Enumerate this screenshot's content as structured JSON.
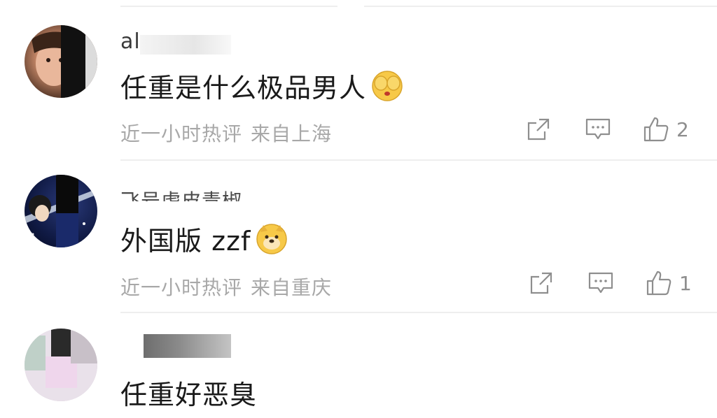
{
  "comments": [
    {
      "username": "al",
      "text": "任重是什么极品男人",
      "emoji": "covering-eyes-emoji",
      "time": "近一小时热评",
      "location": "来自上海",
      "likes": "2"
    },
    {
      "username": "飞号虎皮青椒",
      "text": "外国版 zzf",
      "emoji": "doge-emoji",
      "time": "近一小时热评",
      "location": "来自重庆",
      "likes": "1"
    },
    {
      "username": "",
      "text": "任重好恶臭"
    }
  ],
  "icons": {
    "share": "share-icon",
    "reply": "comment-icon",
    "like": "thumbs-up-icon"
  },
  "colors": {
    "meta_text": "#a8a8a8",
    "icon": "#8e8e8e",
    "divider": "#eeeeee",
    "emoji_yellow": "#f7c948"
  }
}
